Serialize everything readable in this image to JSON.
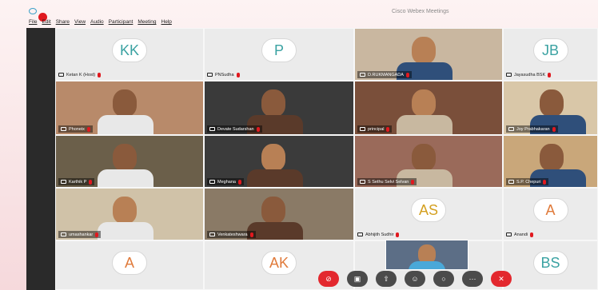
{
  "window": {
    "title": "Cisco Webex Meetings"
  },
  "menu": [
    "File",
    "Edit",
    "Share",
    "View",
    "Audio",
    "Participant",
    "Meeting",
    "Help"
  ],
  "tiles": [
    {
      "name": "Ketan K (Host)",
      "initials": "KK",
      "video": false
    },
    {
      "name": "PNSudha",
      "initials": "P",
      "video": false
    },
    {
      "name": "D.RUKMANGADA",
      "initials": "",
      "video": true
    },
    {
      "name": "Jayasudha BSK",
      "initials": "JB",
      "video": false
    },
    {
      "name": "Phoneix",
      "initials": "",
      "video": true
    },
    {
      "name": "Devate Sudarshan",
      "initials": "",
      "video": true
    },
    {
      "name": "principal",
      "initials": "",
      "video": true
    },
    {
      "name": "Joy Prabhakaran",
      "initials": "",
      "video": true
    },
    {
      "name": "Karthik P",
      "initials": "",
      "video": true
    },
    {
      "name": "Meghana",
      "initials": "",
      "video": true
    },
    {
      "name": "S Sethu Selvi Selvan",
      "initials": "",
      "video": true
    },
    {
      "name": "S.P. Chepuri",
      "initials": "",
      "video": true
    },
    {
      "name": "umashankar",
      "initials": "",
      "video": true
    },
    {
      "name": "Venkateshwara",
      "initials": "",
      "video": true
    },
    {
      "name": "Abhijith Sudhir",
      "initials": "AS",
      "video": false
    },
    {
      "name": "Anandi",
      "initials": "A",
      "video": false
    },
    {
      "name": "",
      "initials": "A",
      "video": false
    },
    {
      "name": "",
      "initials": "AK",
      "video": false
    },
    {
      "name": "",
      "initials": "",
      "video": false
    },
    {
      "name": "",
      "initials": "BS",
      "video": false
    }
  ],
  "toolbar": {
    "mute_icon": "microphone-muted-icon",
    "video_icon": "camera-icon",
    "share_icon": "share-icon",
    "participants_icon": "participants-icon",
    "chat_icon": "chat-icon",
    "more_icon": "more-icon",
    "leave_icon": "close-icon"
  },
  "colors": {
    "end_red": "#e3282e",
    "avatar_text": "#3aa2a2"
  }
}
